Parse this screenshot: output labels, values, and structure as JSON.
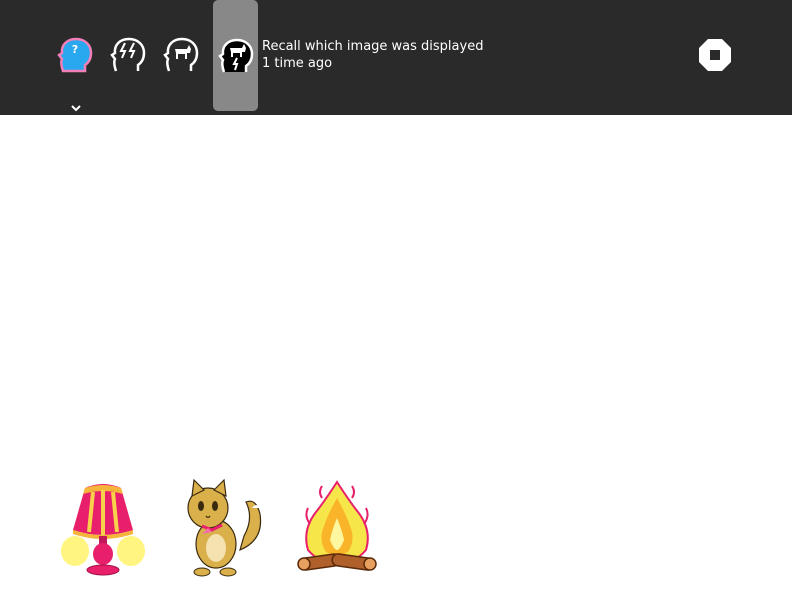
{
  "toolbar": {
    "tools": [
      {
        "name": "help",
        "icon": "head-question-icon"
      },
      {
        "name": "mode-1",
        "icon": "head-lightning-icon"
      },
      {
        "name": "mode-2",
        "icon": "head-animal-icon"
      },
      {
        "name": "mode-3",
        "icon": "head-animal-lightning-icon",
        "active": true
      }
    ],
    "instruction": {
      "line1": "Recall which image was displayed",
      "line2": "1 time ago"
    },
    "stop_icon": "stop-icon"
  },
  "choices": [
    {
      "name": "lamp",
      "icon": "lamp-picture"
    },
    {
      "name": "cat",
      "icon": "cat-picture"
    },
    {
      "name": "campfire",
      "icon": "campfire-picture"
    }
  ],
  "colors": {
    "topbar": "#2a2a2a",
    "active_tool": "#888888",
    "help_head": "#29a8f0",
    "help_outline": "#f080b8"
  }
}
